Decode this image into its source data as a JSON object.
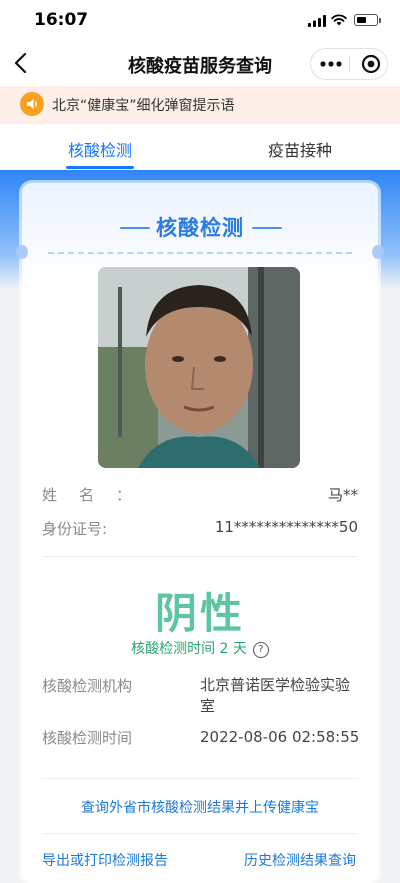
{
  "status_bar": {
    "time": "16:07"
  },
  "nav": {
    "title": "核酸疫苗服务查询"
  },
  "notice": {
    "text": "北京“健康宝”细化弹窗提示语"
  },
  "tabs": [
    {
      "label": "核酸检测",
      "active": true
    },
    {
      "label": "疫苗接种",
      "active": false
    }
  ],
  "card": {
    "title": "核酸检测",
    "name_label": "姓名：",
    "name_value": "马**",
    "id_label": "身份证号:",
    "id_value": "11**************50",
    "result": "阴性",
    "since_text": "核酸检测时间 2 天",
    "help_icon_text": "?",
    "org_label": "核酸检测机构",
    "org_value": "北京普诺医学检验实验室",
    "time_label": "核酸检测时间",
    "time_value": "2022-08-06 02:58:55",
    "query_link": "查询外省市核酸检测结果并上传健康宝",
    "export_link": "导出或打印检测报告",
    "history_link": "历史检测结果查询"
  },
  "colors": {
    "accent_blue": "#1677ff",
    "result_green": "#5dc5a0",
    "notice_bg": "#fdeee8"
  },
  "icons": [
    "back-chevron-icon",
    "more-dots-icon",
    "target-icon",
    "speaker-icon",
    "help-icon"
  ]
}
